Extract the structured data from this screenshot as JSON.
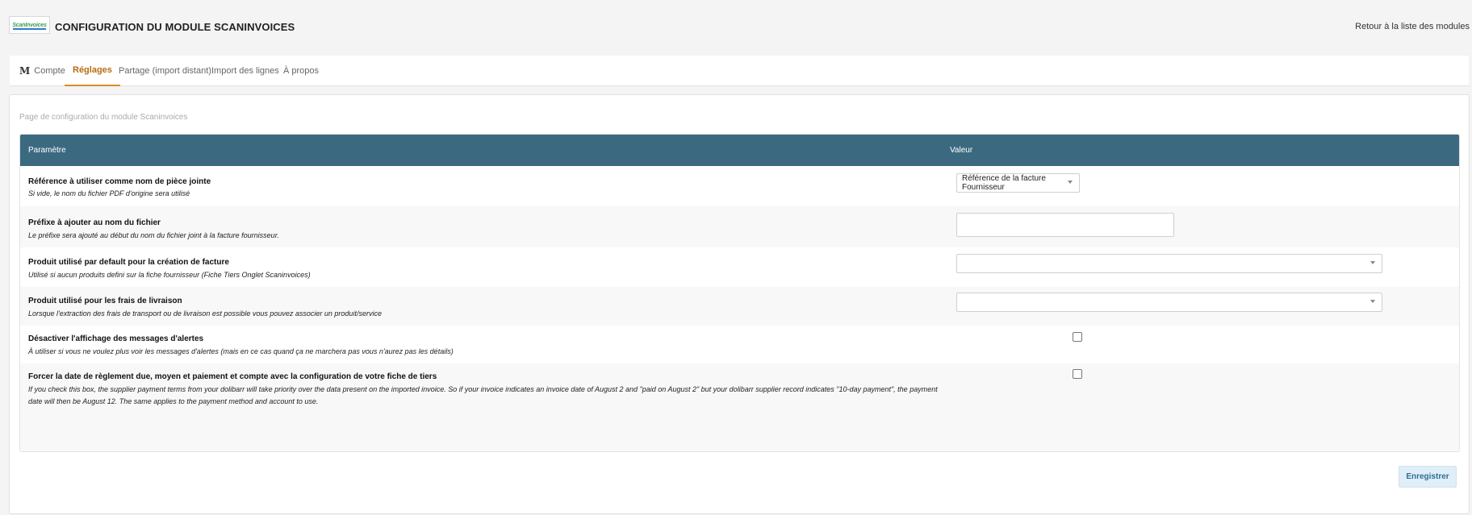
{
  "header": {
    "logo_text": "ScanInvoices",
    "title": "CONFIGURATION DU MODULE SCANINVOICES",
    "back_link": "Retour à la liste des modules"
  },
  "tabs": [
    {
      "label": "Compte",
      "icon": "m-logo-icon",
      "icon_glyph": "M",
      "active": false
    },
    {
      "label": "Réglages",
      "active": true
    },
    {
      "label": "Partage (import distant)",
      "active": false
    },
    {
      "label": "Import des lignes",
      "active": false
    },
    {
      "label": "À propos",
      "active": false
    }
  ],
  "panel": {
    "description": "Page de configuration du module Scaninvoices"
  },
  "table": {
    "col_param": "Paramètre",
    "col_value": "Valeur",
    "rows": [
      {
        "label": "Référence à utiliser comme nom de pièce jointe",
        "help": "Si vide, le nom du fichier PDF d'origine sera utilisé",
        "control": "select",
        "value": "Référence de la facture Fournisseur"
      },
      {
        "label": "Préfixe à ajouter au nom du fichier",
        "help": "Le préfixe sera ajouté au début du nom du fichier joint à la facture fournisseur.",
        "control": "text",
        "value": ""
      },
      {
        "label": "Produit utilisé par default pour la création de facture",
        "help": "Utilisé si aucun produits defini sur la fiche fournisseur (Fiche Tiers Onglet Scaninvoices)",
        "control": "select",
        "value": ""
      },
      {
        "label": "Produit utilisé pour les frais de livraison",
        "help": "Lorsque l'extraction des frais de transport ou de livraison est possible vous pouvez associer un produit/service",
        "control": "select",
        "value": ""
      },
      {
        "label": "Désactiver l'affichage des messages d'alertes",
        "help": "À utiliser si vous ne voulez plus voir les messages d'alertes (mais en ce cas quand ça ne marchera pas vous n'aurez pas les détails)",
        "control": "checkbox",
        "checked": false
      },
      {
        "label": "Forcer la date de règlement due, moyen et paiement et compte avec la configuration de votre fiche de tiers",
        "help": "If you check this box, the supplier payment terms from your dolibarr will take priority over the data present on the imported invoice. So if your invoice indicates an invoice date of August 2 and \"paid on August 2\" but your dolibarr supplier record indicates \"10-day payment\", the payment date will then be August 12. The same applies to the payment method and account to use.",
        "control": "checkbox",
        "checked": false
      }
    ]
  },
  "actions": {
    "save_label": "Enregistrer"
  }
}
